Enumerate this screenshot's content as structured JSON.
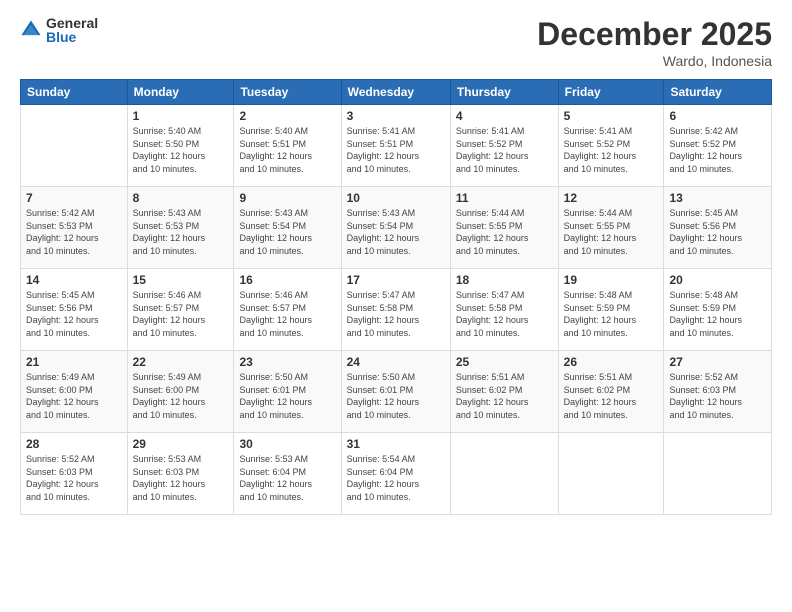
{
  "logo": {
    "general": "General",
    "blue": "Blue"
  },
  "header": {
    "title": "December 2025",
    "subtitle": "Wardo, Indonesia"
  },
  "weekdays": [
    "Sunday",
    "Monday",
    "Tuesday",
    "Wednesday",
    "Thursday",
    "Friday",
    "Saturday"
  ],
  "weeks": [
    [
      {
        "day": "",
        "info": ""
      },
      {
        "day": "1",
        "info": "Sunrise: 5:40 AM\nSunset: 5:50 PM\nDaylight: 12 hours\nand 10 minutes."
      },
      {
        "day": "2",
        "info": "Sunrise: 5:40 AM\nSunset: 5:51 PM\nDaylight: 12 hours\nand 10 minutes."
      },
      {
        "day": "3",
        "info": "Sunrise: 5:41 AM\nSunset: 5:51 PM\nDaylight: 12 hours\nand 10 minutes."
      },
      {
        "day": "4",
        "info": "Sunrise: 5:41 AM\nSunset: 5:52 PM\nDaylight: 12 hours\nand 10 minutes."
      },
      {
        "day": "5",
        "info": "Sunrise: 5:41 AM\nSunset: 5:52 PM\nDaylight: 12 hours\nand 10 minutes."
      },
      {
        "day": "6",
        "info": "Sunrise: 5:42 AM\nSunset: 5:52 PM\nDaylight: 12 hours\nand 10 minutes."
      }
    ],
    [
      {
        "day": "7",
        "info": "Sunrise: 5:42 AM\nSunset: 5:53 PM\nDaylight: 12 hours\nand 10 minutes."
      },
      {
        "day": "8",
        "info": "Sunrise: 5:43 AM\nSunset: 5:53 PM\nDaylight: 12 hours\nand 10 minutes."
      },
      {
        "day": "9",
        "info": "Sunrise: 5:43 AM\nSunset: 5:54 PM\nDaylight: 12 hours\nand 10 minutes."
      },
      {
        "day": "10",
        "info": "Sunrise: 5:43 AM\nSunset: 5:54 PM\nDaylight: 12 hours\nand 10 minutes."
      },
      {
        "day": "11",
        "info": "Sunrise: 5:44 AM\nSunset: 5:55 PM\nDaylight: 12 hours\nand 10 minutes."
      },
      {
        "day": "12",
        "info": "Sunrise: 5:44 AM\nSunset: 5:55 PM\nDaylight: 12 hours\nand 10 minutes."
      },
      {
        "day": "13",
        "info": "Sunrise: 5:45 AM\nSunset: 5:56 PM\nDaylight: 12 hours\nand 10 minutes."
      }
    ],
    [
      {
        "day": "14",
        "info": "Sunrise: 5:45 AM\nSunset: 5:56 PM\nDaylight: 12 hours\nand 10 minutes."
      },
      {
        "day": "15",
        "info": "Sunrise: 5:46 AM\nSunset: 5:57 PM\nDaylight: 12 hours\nand 10 minutes."
      },
      {
        "day": "16",
        "info": "Sunrise: 5:46 AM\nSunset: 5:57 PM\nDaylight: 12 hours\nand 10 minutes."
      },
      {
        "day": "17",
        "info": "Sunrise: 5:47 AM\nSunset: 5:58 PM\nDaylight: 12 hours\nand 10 minutes."
      },
      {
        "day": "18",
        "info": "Sunrise: 5:47 AM\nSunset: 5:58 PM\nDaylight: 12 hours\nand 10 minutes."
      },
      {
        "day": "19",
        "info": "Sunrise: 5:48 AM\nSunset: 5:59 PM\nDaylight: 12 hours\nand 10 minutes."
      },
      {
        "day": "20",
        "info": "Sunrise: 5:48 AM\nSunset: 5:59 PM\nDaylight: 12 hours\nand 10 minutes."
      }
    ],
    [
      {
        "day": "21",
        "info": "Sunrise: 5:49 AM\nSunset: 6:00 PM\nDaylight: 12 hours\nand 10 minutes."
      },
      {
        "day": "22",
        "info": "Sunrise: 5:49 AM\nSunset: 6:00 PM\nDaylight: 12 hours\nand 10 minutes."
      },
      {
        "day": "23",
        "info": "Sunrise: 5:50 AM\nSunset: 6:01 PM\nDaylight: 12 hours\nand 10 minutes."
      },
      {
        "day": "24",
        "info": "Sunrise: 5:50 AM\nSunset: 6:01 PM\nDaylight: 12 hours\nand 10 minutes."
      },
      {
        "day": "25",
        "info": "Sunrise: 5:51 AM\nSunset: 6:02 PM\nDaylight: 12 hours\nand 10 minutes."
      },
      {
        "day": "26",
        "info": "Sunrise: 5:51 AM\nSunset: 6:02 PM\nDaylight: 12 hours\nand 10 minutes."
      },
      {
        "day": "27",
        "info": "Sunrise: 5:52 AM\nSunset: 6:03 PM\nDaylight: 12 hours\nand 10 minutes."
      }
    ],
    [
      {
        "day": "28",
        "info": "Sunrise: 5:52 AM\nSunset: 6:03 PM\nDaylight: 12 hours\nand 10 minutes."
      },
      {
        "day": "29",
        "info": "Sunrise: 5:53 AM\nSunset: 6:03 PM\nDaylight: 12 hours\nand 10 minutes."
      },
      {
        "day": "30",
        "info": "Sunrise: 5:53 AM\nSunset: 6:04 PM\nDaylight: 12 hours\nand 10 minutes."
      },
      {
        "day": "31",
        "info": "Sunrise: 5:54 AM\nSunset: 6:04 PM\nDaylight: 12 hours\nand 10 minutes."
      },
      {
        "day": "",
        "info": ""
      },
      {
        "day": "",
        "info": ""
      },
      {
        "day": "",
        "info": ""
      }
    ]
  ]
}
